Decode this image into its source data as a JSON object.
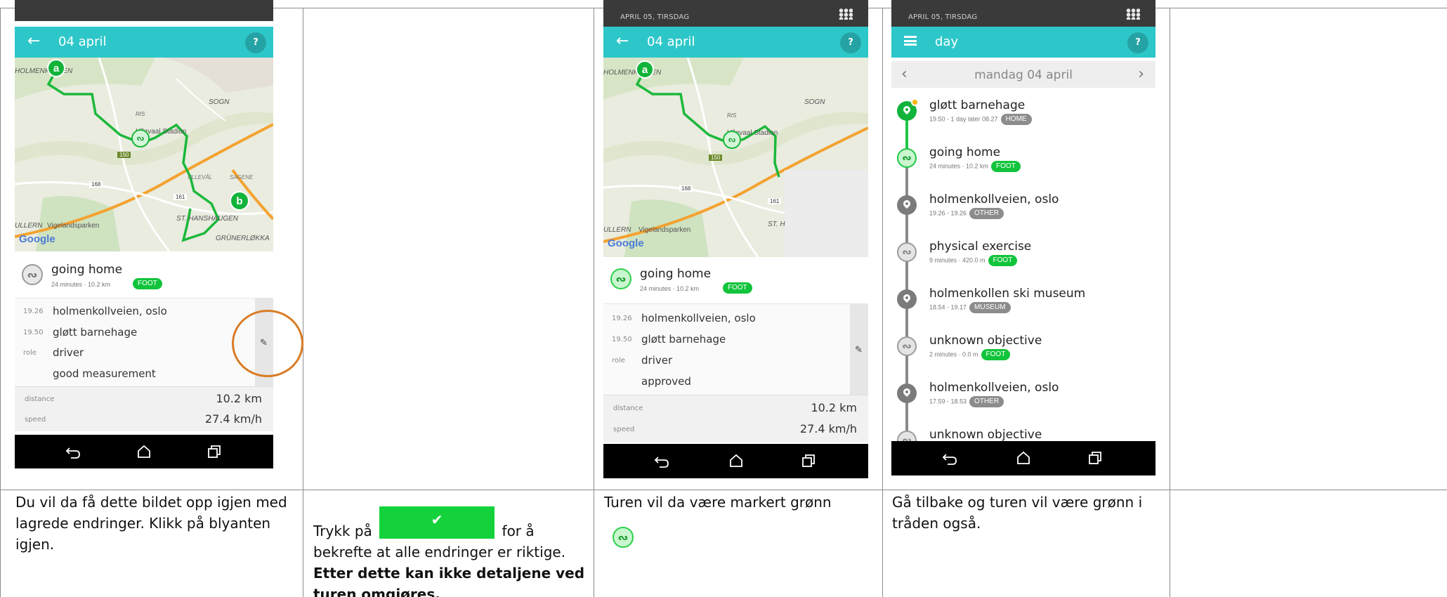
{
  "document": {
    "captions": [
      {
        "text": "Du vil da få dette bildet opp igjen med lagrede endringer. Klikk på blyanten igjen."
      },
      {
        "pre": "Trykk på",
        "post": "for å bekrefte at alle endringer er riktige.",
        "bold": "Etter dette kan ikke detaljene ved turen omgjøres."
      },
      {
        "text": "Turen vil da være markert grønn"
      },
      {
        "text": "Gå tilbake og turen vil være grønn i tråden også."
      }
    ],
    "colors": {
      "highlight_circle": "#d97c25",
      "confirm_button": "#14d23b",
      "grid_lines": "#8c8c8c"
    }
  },
  "screens": {
    "trip_a": {
      "title": "04 april",
      "help": "?",
      "map_labels": {
        "holmen": "HOLMENKOLLEN",
        "sogn": "SOGN",
        "ris": "RIS",
        "stadion": "Ullevaal Stadion",
        "ulleval": "ULLEVÅL",
        "sagene": "SAGENE",
        "st_hans": "ST. HANSHAUGEN",
        "vigeland": "Vigelandsparken",
        "ullern": "ULLERN",
        "grunerlokka": "GRÜNERLØKKA",
        "road150": "150",
        "road168": "168",
        "road161": "161",
        "google": "Google",
        "marker_a": "a",
        "marker_b": "b"
      },
      "trip": {
        "title": "going home",
        "meta": "24 minutes  ·  10.2 km",
        "badge": "FOOT",
        "icon": "walk-icon"
      },
      "details": [
        {
          "key": "19.26",
          "value": "holmenkollveien, oslo"
        },
        {
          "key": "19.50",
          "value": "gløtt barnehage"
        },
        {
          "key": "role",
          "value": "driver"
        },
        {
          "key": "",
          "value": "good measurement"
        }
      ],
      "stats": [
        {
          "key": "distance",
          "value": "10.2 km"
        },
        {
          "key": "speed",
          "value": "27.4 km/h"
        }
      ]
    },
    "trip_b": {
      "clock": "APRIL 05, TIRSDAG",
      "title": "04 april",
      "help": "?",
      "map_labels": {
        "holmen": "HOLMENKOLLEN",
        "sogn": "SOGN",
        "ris": "RIS",
        "stadion": "Ullevaal Stadion",
        "vigeland": "Vigelandsparken",
        "ullern": "ULLERN",
        "st": "ST. H",
        "road150": "150",
        "road168": "168",
        "road161": "161",
        "google": "Google",
        "marker_a": "a"
      },
      "trip": {
        "title": "going home",
        "meta": "24 minutes  ·  10.2 km",
        "badge": "FOOT",
        "icon": "walk-icon"
      },
      "details": [
        {
          "key": "19.26",
          "value": "holmenkollveien, oslo"
        },
        {
          "key": "19.50",
          "value": "gløtt barnehage"
        },
        {
          "key": "role",
          "value": "driver"
        },
        {
          "key": "",
          "value": "approved"
        }
      ],
      "stats": [
        {
          "key": "distance",
          "value": "10.2 km"
        },
        {
          "key": "speed",
          "value": "27.4 km/h"
        }
      ]
    },
    "day": {
      "clock": "APRIL 05, TIRSDAG",
      "title": "day",
      "help": "?",
      "date_label": "mandag 04 april",
      "items": [
        {
          "title": "gløtt barnehage",
          "meta": "19.50 - 1 day later 08.27",
          "badge": "HOME",
          "badge_color": "grey",
          "kind": "place-green"
        },
        {
          "title": "going home",
          "meta": "24 minutes  ·  10.2 km",
          "badge": "FOOT",
          "badge_color": "green",
          "kind": "trip-green"
        },
        {
          "title": "holmenkollveien, oslo",
          "meta": "19.26 - 19.26",
          "badge": "OTHER",
          "badge_color": "grey",
          "kind": "place"
        },
        {
          "title": "physical exercise",
          "meta": "9 minutes  ·  420.0 m",
          "badge": "FOOT",
          "badge_color": "green",
          "kind": "trip"
        },
        {
          "title": "holmenkollen ski museum",
          "meta": "18.54 - 19.17",
          "badge": "MUSEUM",
          "badge_color": "grey",
          "kind": "place"
        },
        {
          "title": "unknown objective",
          "meta": "2 minutes  ·  0.0 m",
          "badge": "FOOT",
          "badge_color": "green",
          "kind": "trip"
        },
        {
          "title": "holmenkollveien, oslo",
          "meta": "17.59 - 18.53",
          "badge": "OTHER",
          "badge_color": "grey",
          "kind": "place"
        },
        {
          "title": "unknown objective",
          "meta": "",
          "badge": "",
          "badge_color": "",
          "kind": "trip"
        }
      ]
    }
  },
  "icons": {
    "back": "back-arrow-icon",
    "home": "home-icon",
    "recents": "recents-icon",
    "pencil": "pencil-icon",
    "check": "check-icon",
    "menu": "menu-icon",
    "apps": "apps-grid-icon"
  }
}
